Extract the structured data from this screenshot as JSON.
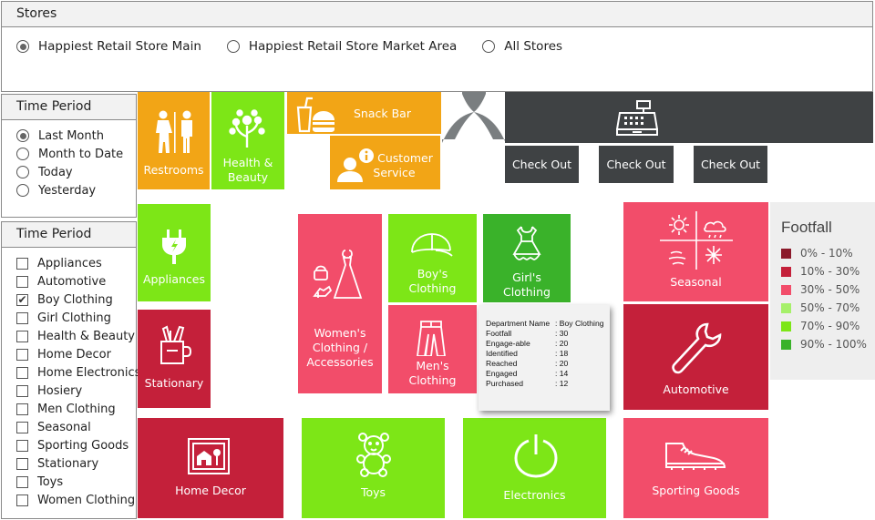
{
  "stores": {
    "title": "Stores",
    "options": [
      {
        "label": "Happiest Retail Store Main",
        "selected": true
      },
      {
        "label": "Happiest Retail Store Market Area",
        "selected": false
      },
      {
        "label": "All Stores",
        "selected": false
      }
    ]
  },
  "time_period": {
    "title": "Time Period",
    "options": [
      {
        "label": "Last Month",
        "selected": true
      },
      {
        "label": "Month to Date",
        "selected": false
      },
      {
        "label": "Today",
        "selected": false
      },
      {
        "label": "Yesterday",
        "selected": false
      }
    ]
  },
  "categories": {
    "title": "Time Period",
    "items": [
      {
        "label": "Appliances",
        "checked": false
      },
      {
        "label": "Automotive",
        "checked": false
      },
      {
        "label": "Boy Clothing",
        "checked": true
      },
      {
        "label": "Girl Clothing",
        "checked": false
      },
      {
        "label": "Health & Beauty",
        "checked": false
      },
      {
        "label": "Home Decor",
        "checked": false
      },
      {
        "label": "Home Electronics",
        "checked": false
      },
      {
        "label": "Hosiery",
        "checked": false
      },
      {
        "label": "Men Clothing",
        "checked": false
      },
      {
        "label": "Seasonal",
        "checked": false
      },
      {
        "label": "Sporting Goods",
        "checked": false
      },
      {
        "label": "Stationary",
        "checked": false
      },
      {
        "label": "Toys",
        "checked": false
      },
      {
        "label": "Women Clothing",
        "checked": false
      }
    ]
  },
  "map": {
    "restrooms": {
      "label": "Restrooms",
      "icon": "restroom-icon"
    },
    "health_beauty": {
      "line1": "Health &",
      "line2": "Beauty",
      "icon": "plant-icon"
    },
    "snack_bar": {
      "label": "Snack Bar",
      "icon": "snack-icon"
    },
    "customer_service": {
      "line1": "Customer",
      "line2": "Service",
      "icon": "customer-service-icon"
    },
    "checkout_counter": {
      "icon": "cash-register-icon"
    },
    "checkouts": [
      "Check Out",
      "Check Out",
      "Check Out"
    ],
    "appliances": {
      "label": "Appliances",
      "icon": "plug-icon"
    },
    "womens": {
      "line1": "Women's",
      "line2": "Clothing /",
      "line3": "Accessories",
      "icon": "dress-icon"
    },
    "boys": {
      "line1": "Boy's",
      "line2": "Clothing",
      "icon": "cap-icon"
    },
    "girls": {
      "line1": "Girl's",
      "line2": "Clothing",
      "icon": "girl-dress-icon"
    },
    "mens": {
      "line1": "Men's",
      "line2": "Clothing",
      "icon": "shirt-icon"
    },
    "seasonal": {
      "label": "Seasonal",
      "icon": "weather-icon"
    },
    "stationary": {
      "label": "Stationary",
      "icon": "pen-cup-icon"
    },
    "automotive": {
      "label": "Automotive",
      "icon": "wrench-icon"
    },
    "home_decor": {
      "label": "Home Decor",
      "icon": "picture-frame-icon"
    },
    "toys": {
      "label": "Toys",
      "icon": "teddy-bear-icon"
    },
    "electronics": {
      "label": "Electronics",
      "icon": "power-icon"
    },
    "sporting_goods": {
      "label": "Sporting Goods",
      "icon": "shoe-icon"
    }
  },
  "tooltip": {
    "rows": [
      {
        "key": "Department Name",
        "value": ": Boy Clothing"
      },
      {
        "key": "Footfall",
        "value": ": 30"
      },
      {
        "key": "Engage-able",
        "value": ": 20"
      },
      {
        "key": "Identified",
        "value": ": 18"
      },
      {
        "key": "Reached",
        "value": ": 20"
      },
      {
        "key": "Engaged",
        "value": ": 14"
      },
      {
        "key": "Purchased",
        "value": ": 12"
      }
    ]
  },
  "legend": {
    "title": "Footfall",
    "items": [
      {
        "label": "0% - 10%",
        "color": "#8b1a2b"
      },
      {
        "label": "10% - 30%",
        "color": "#c4203a"
      },
      {
        "label": "30% - 50%",
        "color": "#f24d6a"
      },
      {
        "label": "50% - 70%",
        "color": "#a6f06a"
      },
      {
        "label": "70% - 90%",
        "color": "#7de617"
      },
      {
        "label": "90% - 100%",
        "color": "#3ab22a"
      }
    ]
  }
}
